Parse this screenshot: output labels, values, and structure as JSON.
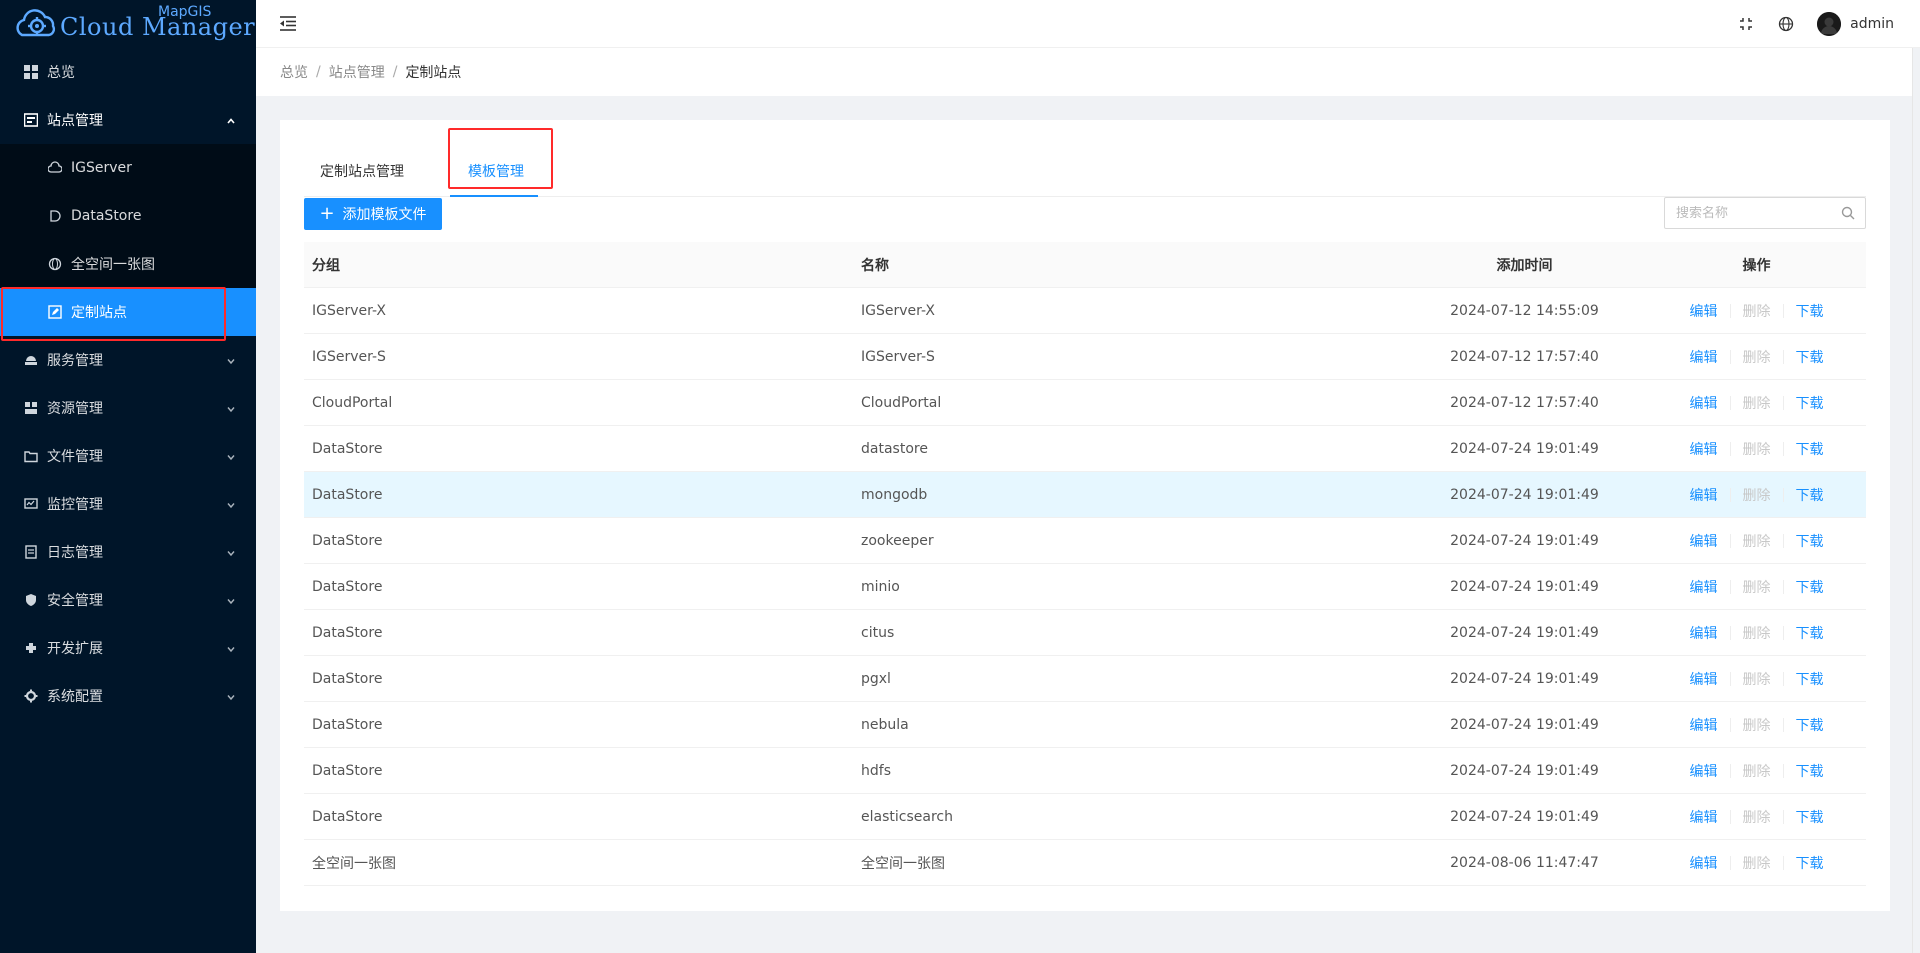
{
  "app": {
    "logo_text": "Cloud Manager",
    "logo_sup": "MapGIS"
  },
  "sidebar": {
    "items": [
      {
        "label": "总览",
        "icon": "dashboard-icon"
      },
      {
        "label": "站点管理",
        "icon": "site-icon",
        "open": true,
        "children": [
          {
            "label": "IGServer",
            "icon": "cloud-icon"
          },
          {
            "label": "DataStore",
            "icon": "datastore-icon"
          },
          {
            "label": "全空间一张图",
            "icon": "globe-icon"
          },
          {
            "label": "定制站点",
            "icon": "edit-icon",
            "active": true
          }
        ]
      },
      {
        "label": "服务管理",
        "icon": "service-icon"
      },
      {
        "label": "资源管理",
        "icon": "resource-icon"
      },
      {
        "label": "文件管理",
        "icon": "folder-icon"
      },
      {
        "label": "监控管理",
        "icon": "monitor-icon"
      },
      {
        "label": "日志管理",
        "icon": "log-icon"
      },
      {
        "label": "安全管理",
        "icon": "shield-icon"
      },
      {
        "label": "开发扩展",
        "icon": "plugin-icon"
      },
      {
        "label": "系统配置",
        "icon": "gear-icon"
      }
    ]
  },
  "header": {
    "username": "admin",
    "icons": [
      "menu-fold-icon",
      "fullscreen-icon",
      "globe-icon",
      "avatar"
    ]
  },
  "breadcrumb": [
    "总览",
    "站点管理",
    "定制站点"
  ],
  "tabs": [
    {
      "label": "定制站点管理",
      "active": false
    },
    {
      "label": "模板管理",
      "active": true
    }
  ],
  "toolbar": {
    "add_label": "添加模板文件",
    "search_placeholder": "搜索名称"
  },
  "table": {
    "columns": [
      "分组",
      "名称",
      "添加时间",
      "操作"
    ],
    "actions": {
      "edit": "编辑",
      "delete": "删除",
      "download": "下载"
    },
    "rows": [
      {
        "group": "IGServer-X",
        "name": "IGServer-X",
        "time": "2024-07-12 14:55:09"
      },
      {
        "group": "IGServer-S",
        "name": "IGServer-S",
        "time": "2024-07-12 17:57:40"
      },
      {
        "group": "CloudPortal",
        "name": "CloudPortal",
        "time": "2024-07-12 17:57:40"
      },
      {
        "group": "DataStore",
        "name": "datastore",
        "time": "2024-07-24 19:01:49"
      },
      {
        "group": "DataStore",
        "name": "mongodb",
        "time": "2024-07-24 19:01:49",
        "hover": true
      },
      {
        "group": "DataStore",
        "name": "zookeeper",
        "time": "2024-07-24 19:01:49"
      },
      {
        "group": "DataStore",
        "name": "minio",
        "time": "2024-07-24 19:01:49"
      },
      {
        "group": "DataStore",
        "name": "citus",
        "time": "2024-07-24 19:01:49"
      },
      {
        "group": "DataStore",
        "name": "pgxl",
        "time": "2024-07-24 19:01:49"
      },
      {
        "group": "DataStore",
        "name": "nebula",
        "time": "2024-07-24 19:01:49"
      },
      {
        "group": "DataStore",
        "name": "hdfs",
        "time": "2024-07-24 19:01:49"
      },
      {
        "group": "DataStore",
        "name": "elasticsearch",
        "time": "2024-07-24 19:01:49"
      },
      {
        "group": "全空间一张图",
        "name": "全空间一张图",
        "time": "2024-08-06 11:47:47"
      }
    ]
  },
  "colors": {
    "primary": "#1890ff",
    "sidebar_bg": "#001529",
    "highlight_box": "#ff2a2a"
  }
}
